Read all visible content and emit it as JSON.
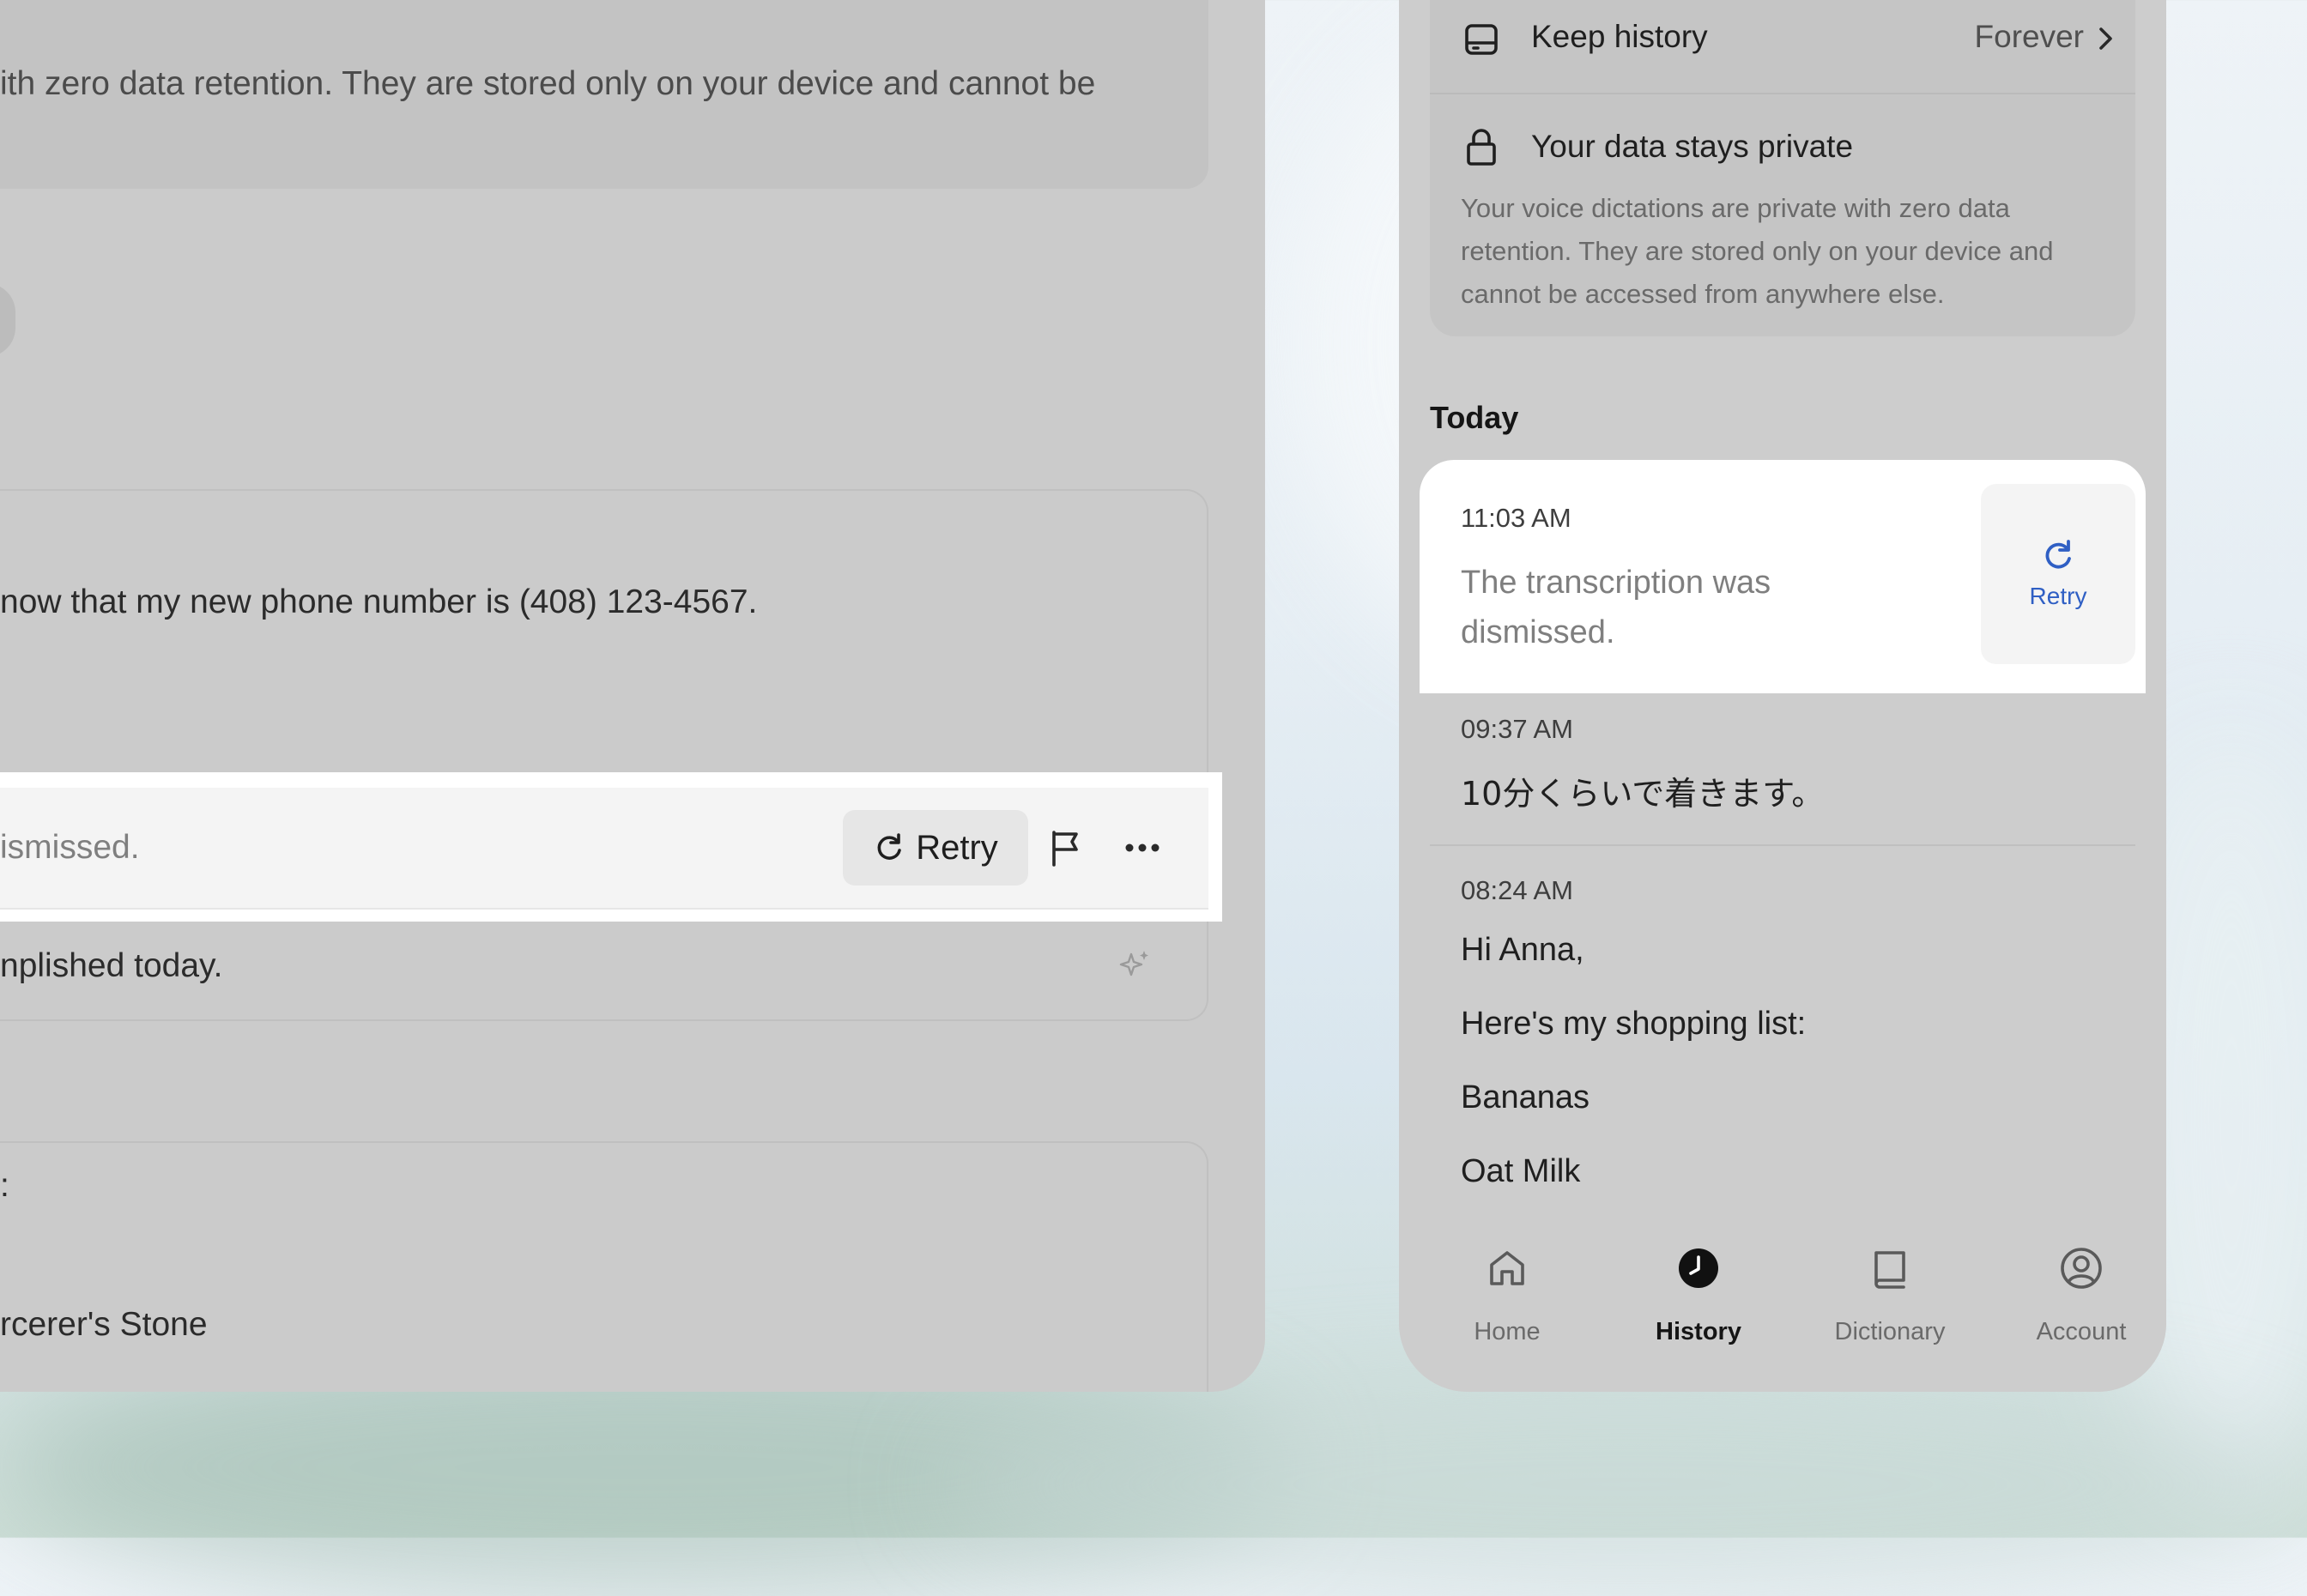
{
  "desktop": {
    "info_text": "ith zero data retention. They are stored only on your device and cannot be",
    "card1_line1": "now that my new phone number is (408) 123-4567.",
    "highlight": {
      "status_text": "ismissed.",
      "retry_label": "Retry",
      "icons": [
        "retry-icon",
        "flag-icon",
        "more-icon"
      ]
    },
    "card1_line2": "nplished today.",
    "card2_colon": ":",
    "card2_line": "rcerer's Stone"
  },
  "mobile": {
    "settings": {
      "keep_history_label": "Keep history",
      "keep_history_value": "Forever",
      "private_title": "Your data stays private",
      "private_desc": "Your voice dictations are private with zero data retention. They are stored only on your device and cannot be accessed from anywhere else."
    },
    "section_today": "Today",
    "entries": [
      {
        "time": "11:03 AM",
        "text": "The transcription was dismissed.",
        "action": "Retry"
      },
      {
        "time": "09:37 AM",
        "text": "10分くらいで着きます。"
      },
      {
        "time": "08:24 AM",
        "lines": [
          "Hi Anna,",
          "Here's my shopping list:",
          "Bananas",
          "Oat Milk"
        ]
      }
    ],
    "nav": [
      {
        "label": "Home",
        "icon": "home-icon"
      },
      {
        "label": "History",
        "icon": "clock-icon",
        "active": true
      },
      {
        "label": "Dictionary",
        "icon": "book-icon"
      },
      {
        "label": "Account",
        "icon": "account-icon"
      }
    ]
  },
  "colors": {
    "highlight": "#ffffff",
    "accent_blue": "#2f5fc4",
    "dim_overlay": "#cbcbcb"
  }
}
